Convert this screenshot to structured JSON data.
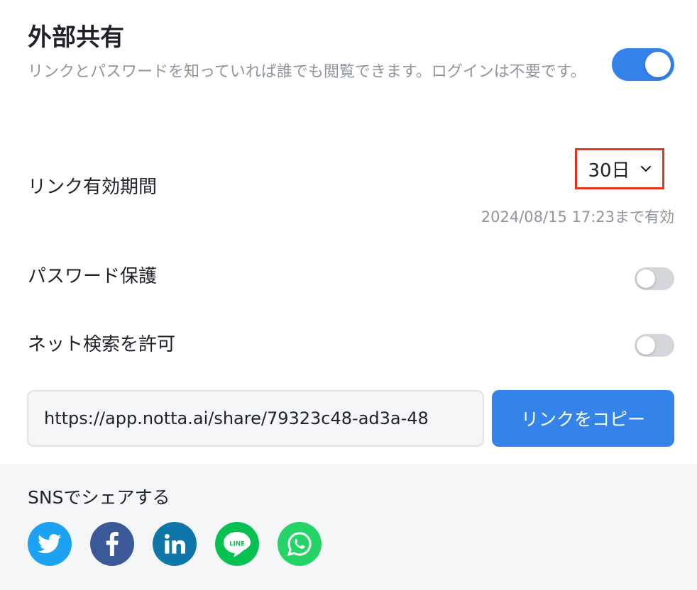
{
  "header": {
    "title": "外部共有",
    "description": "リンクとパスワードを知っていれば誰でも閲覧できます。ログインは不要です。",
    "enabled": true
  },
  "link_expiry": {
    "label": "リンク有効期間",
    "value": "30日",
    "note": "2024/08/15 17:23まで有効"
  },
  "password_protection": {
    "label": "パスワード保護",
    "enabled": false
  },
  "search_indexing": {
    "label": "ネット検索を許可",
    "enabled": false
  },
  "share_link": {
    "url": "https://app.notta.ai/share/79323c48-ad3a-48",
    "copy_label": "リンクをコピー"
  },
  "sns": {
    "title": "SNSでシェアする",
    "items": [
      {
        "name": "twitter",
        "color": "#1da1f2"
      },
      {
        "name": "facebook",
        "color": "#3b5998"
      },
      {
        "name": "linkedin",
        "color": "#0e76a8"
      },
      {
        "name": "line",
        "color": "#06c152"
      },
      {
        "name": "whatsapp",
        "color": "#25d366"
      }
    ]
  }
}
